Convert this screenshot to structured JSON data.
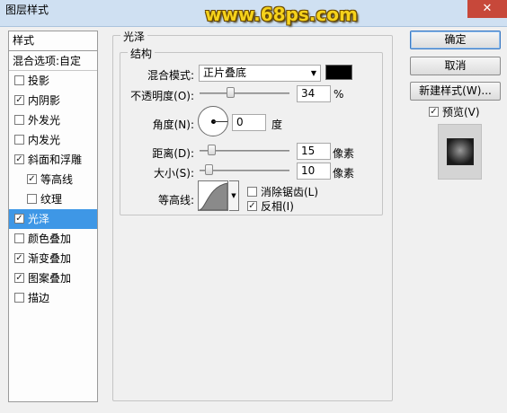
{
  "window": {
    "title": "图层样式",
    "close_glyph": "✕",
    "watermark": "www.68ps.com"
  },
  "sidebar": {
    "header": "样式",
    "blend_options": "混合选项:自定",
    "items": [
      {
        "label": "投影",
        "checked": false
      },
      {
        "label": "内阴影",
        "checked": true
      },
      {
        "label": "外发光",
        "checked": false
      },
      {
        "label": "内发光",
        "checked": false
      },
      {
        "label": "斜面和浮雕",
        "checked": true
      },
      {
        "label": "等高线",
        "checked": true
      },
      {
        "label": "纹理",
        "checked": false
      },
      {
        "label": "光泽",
        "checked": true
      },
      {
        "label": "颜色叠加",
        "checked": false
      },
      {
        "label": "渐变叠加",
        "checked": true
      },
      {
        "label": "图案叠加",
        "checked": true
      },
      {
        "label": "描边",
        "checked": false
      }
    ]
  },
  "satin": {
    "group_title": "光泽",
    "structure_title": "结构",
    "blend_mode_label": "混合模式:",
    "blend_mode_value": "正片叠底",
    "blend_color": "#000000",
    "opacity_label": "不透明度(O):",
    "opacity_value": "34",
    "opacity_unit": "%",
    "angle_label": "角度(N):",
    "angle_value": "0",
    "angle_unit": "度",
    "distance_label": "距离(D):",
    "distance_value": "15",
    "distance_unit": "像素",
    "size_label": "大小(S):",
    "size_value": "10",
    "size_unit": "像素",
    "contour_label": "等高线:",
    "antialias_label": "消除锯齿(L)",
    "antialias_checked": false,
    "invert_label": "反相(I)",
    "invert_checked": true
  },
  "buttons": {
    "ok": "确定",
    "cancel": "取消",
    "new_style": "新建样式(W)...",
    "preview_label": "预览(V)",
    "preview_checked": true
  }
}
